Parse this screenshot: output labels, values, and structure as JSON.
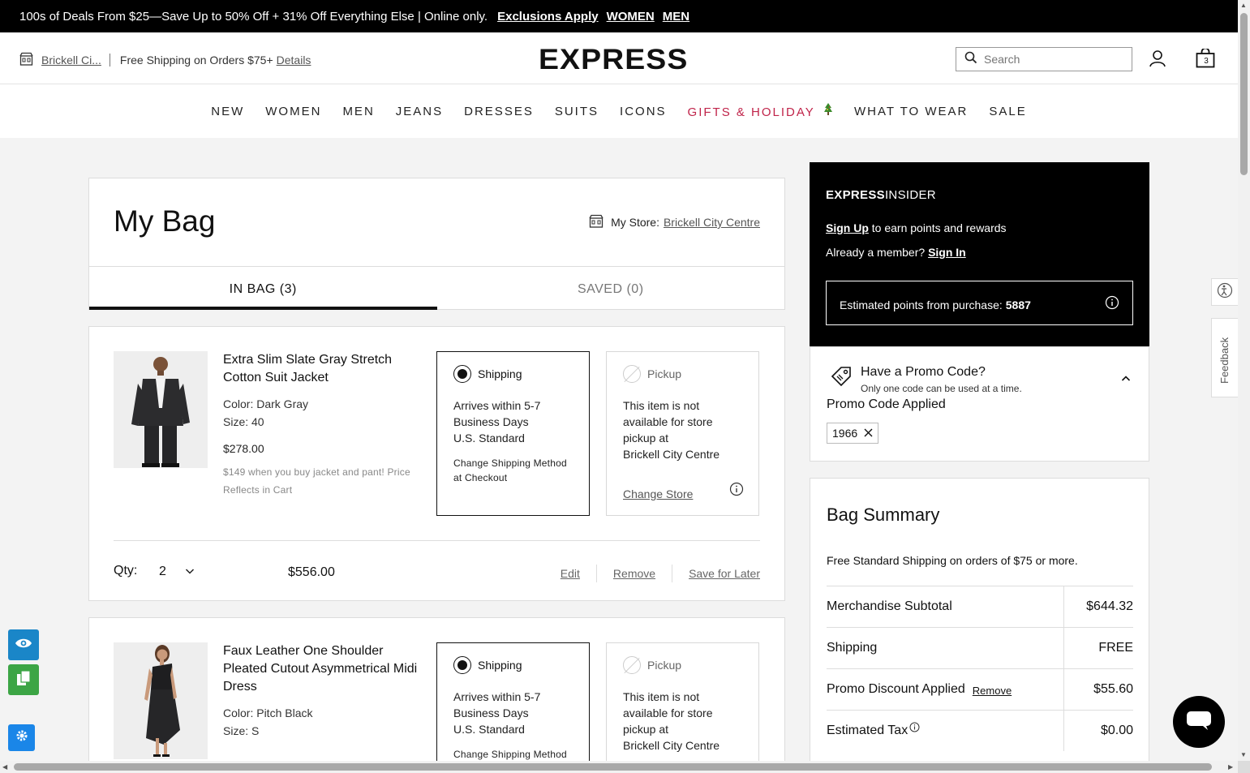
{
  "promo_bar": {
    "text": "100s of Deals From $25—Save Up to 50% Off + 31% Off Everything Else | Online only.",
    "exclusions": "Exclusions Apply",
    "women": "WOMEN",
    "men": "MEN"
  },
  "header": {
    "store_name": "Brickell Ci...",
    "shipping_text": "Free Shipping on Orders $75+",
    "details": "Details",
    "logo": "EXPRESS",
    "search_placeholder": "Search",
    "bag_count": "3"
  },
  "nav": [
    "NEW",
    "WOMEN",
    "MEN",
    "JEANS",
    "DRESSES",
    "SUITS",
    "ICONS",
    "GIFTS & HOLIDAY",
    "WHAT TO WEAR",
    "SALE"
  ],
  "bag": {
    "title": "My Bag",
    "my_store_label": "My Store:",
    "my_store_name": "Brickell City Centre",
    "tab_in_bag": "IN BAG (3)",
    "tab_saved": "SAVED (0)"
  },
  "items": [
    {
      "name": "Extra Slim Slate Gray Stretch Cotton Suit Jacket",
      "color": "Color: Dark Gray",
      "size": "Size: 40",
      "price": "$278.00",
      "note": "$149 when you buy jacket and pant! Price Reflects in Cart",
      "shipping_title": "Shipping",
      "shipping_body_1": "Arrives within 5-7",
      "shipping_body_2": "Business Days",
      "shipping_body_3": "U.S. Standard",
      "shipping_small": "Change Shipping Method at Checkout",
      "pickup_title": "Pickup",
      "pickup_body_1": "This item is not",
      "pickup_body_2": "available for store",
      "pickup_body_3": "pickup at",
      "pickup_body_4": "Brickell City Centre",
      "change_store": "Change Store",
      "qty_label": "Qty:",
      "qty": "2",
      "line_total": "$556.00",
      "edit": "Edit",
      "remove": "Remove",
      "save_later": "Save for Later"
    },
    {
      "name": "Faux Leather One Shoulder Pleated Cutout Asymmetrical Midi Dress",
      "color": "Color: Pitch Black",
      "size": "Size: S",
      "shipping_title": "Shipping",
      "shipping_body_1": "Arrives within 5-7",
      "shipping_body_2": "Business Days",
      "shipping_body_3": "U.S. Standard",
      "shipping_small": "Change Shipping Method",
      "pickup_title": "Pickup",
      "pickup_body_1": "This item is not",
      "pickup_body_2": "available for store",
      "pickup_body_3": "pickup at",
      "pickup_body_4": "Brickell City Centre"
    }
  ],
  "insider": {
    "brand_bold": "EXPRESS",
    "brand_light": "INSIDER",
    "sign_up": "Sign Up",
    "sign_up_rest": "to earn points and rewards",
    "member_text": "Already a member?",
    "sign_in": "Sign In",
    "points_label": "Estimated points from purchase:",
    "points_value": "5887"
  },
  "promo": {
    "heading": "Have a Promo Code?",
    "sub": "Only one code can be used at a time.",
    "applied": "Promo Code Applied",
    "code": "1966"
  },
  "summary": {
    "title": "Bag Summary",
    "free_text": "Free Standard Shipping on orders of $75 or more.",
    "rows": [
      {
        "label": "Merchandise Subtotal",
        "value": "$644.32"
      },
      {
        "label": "Shipping",
        "value": "FREE"
      },
      {
        "label": "Promo Discount Applied",
        "link": "Remove",
        "value": "$55.60"
      },
      {
        "label": "Estimated Tax",
        "value": "$0.00"
      }
    ]
  },
  "feedback": "Feedback",
  "colors": {
    "holiday": "#c0244a",
    "black": "#000000",
    "eye_tool": "#1a86c8",
    "copy_tool": "#3ca545"
  }
}
